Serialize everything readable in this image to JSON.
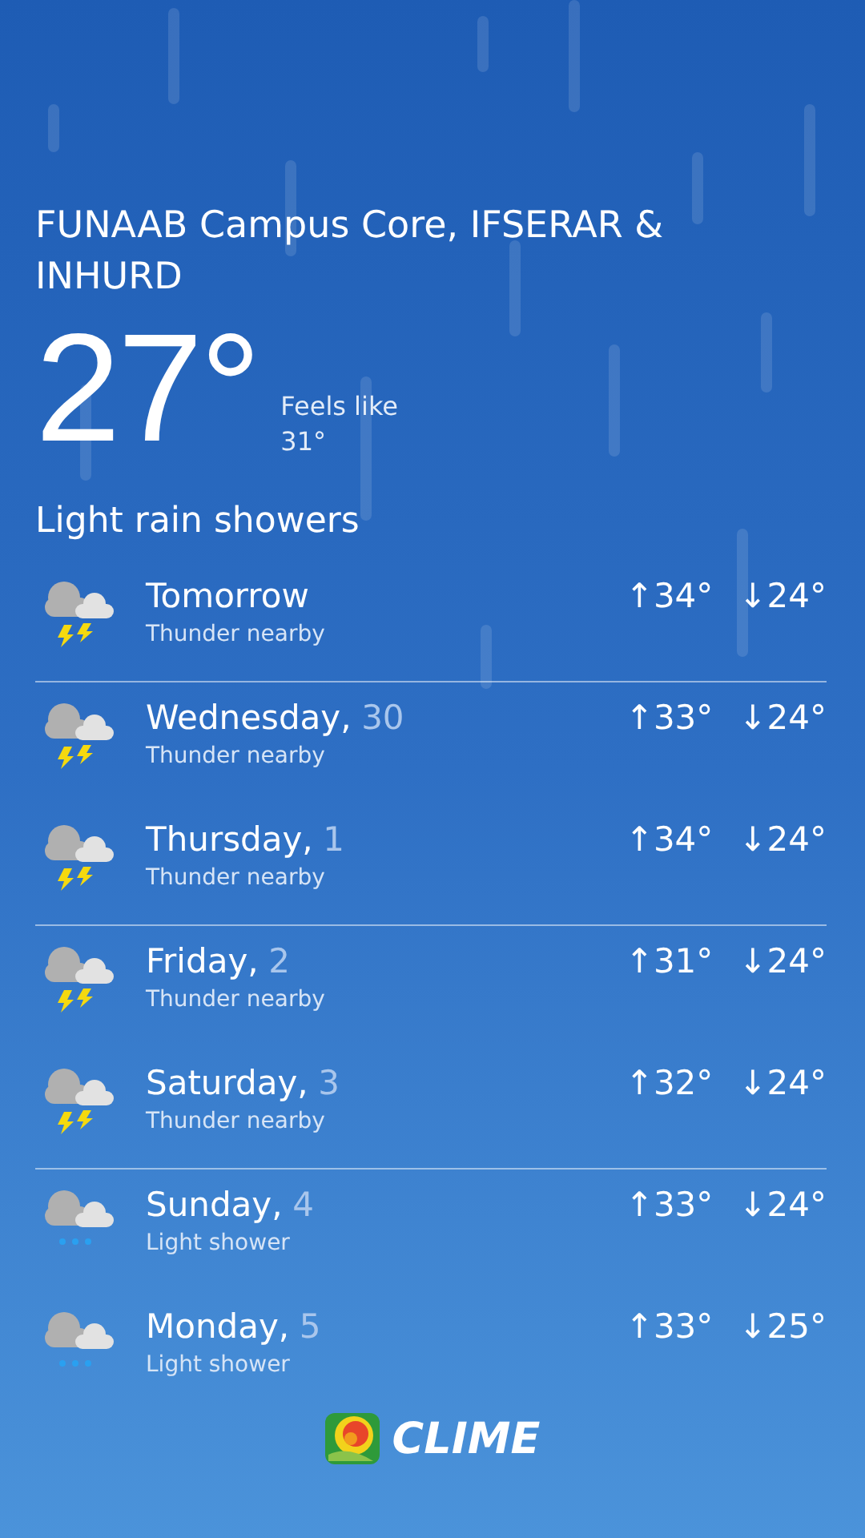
{
  "location": "FUNAAB Campus Core, IFSERAR & INHURD",
  "current": {
    "temperature": "27°",
    "feels_like_label": "Feels like",
    "feels_like": "31°",
    "condition": "Light rain showers"
  },
  "forecast": [
    {
      "kind": "thunder",
      "day": "Tomorrow",
      "summary": "Thunder nearby",
      "high": "↑34°",
      "low": "↓24°",
      "divider": true
    },
    {
      "kind": "thunder",
      "day": "Wednesday,",
      "date": "30",
      "summary": "Thunder nearby",
      "high": "↑33°",
      "low": "↓24°",
      "divider": false
    },
    {
      "kind": "thunder",
      "day": "Thursday,",
      "date": "1",
      "summary": "Thunder nearby",
      "high": "↑34°",
      "low": "↓24°",
      "divider": true
    },
    {
      "kind": "thunder",
      "day": "Friday,",
      "date": "2",
      "summary": "Thunder nearby",
      "high": "↑31°",
      "low": "↓24°",
      "divider": false
    },
    {
      "kind": "thunder",
      "day": "Saturday,",
      "date": "3",
      "summary": "Thunder nearby",
      "high": "↑32°",
      "low": "↓24°",
      "divider": true
    },
    {
      "kind": "shower",
      "day": "Sunday,",
      "date": "4",
      "summary": "Light shower",
      "high": "↑33°",
      "low": "↓24°",
      "divider": false
    },
    {
      "kind": "shower",
      "day": "Monday,",
      "date": "5",
      "summary": "Light shower",
      "high": "↑33°",
      "low": "↓25°",
      "divider": false
    }
  ],
  "brand": "CLIME"
}
